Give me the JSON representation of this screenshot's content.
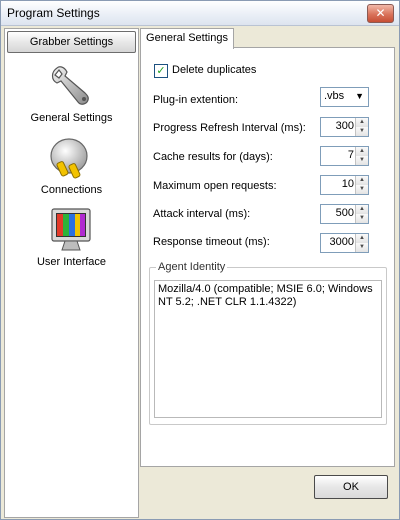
{
  "window": {
    "title": "Program Settings",
    "close_glyph": "✕"
  },
  "left": {
    "header": "Grabber Settings",
    "items": [
      {
        "label": "General Settings",
        "icon": "wrench-icon"
      },
      {
        "label": "Connections",
        "icon": "plug-icon"
      },
      {
        "label": "User Interface",
        "icon": "monitor-icon"
      }
    ]
  },
  "tab": {
    "label": "General Settings"
  },
  "settings": {
    "delete_duplicates": {
      "label": "Delete duplicates",
      "checked": true,
      "check_glyph": "✓"
    },
    "plugin_ext": {
      "label": "Plug-in extention:",
      "value": ".vbs",
      "arrow": "▼"
    },
    "progress_refresh": {
      "label": "Progress Refresh Interval (ms):",
      "value": "300"
    },
    "cache_results": {
      "label": "Cache results for (days):",
      "value": "7"
    },
    "max_requests": {
      "label": "Maximum open requests:",
      "value": "10"
    },
    "attack_interval": {
      "label": "Attack interval (ms):",
      "value": "500"
    },
    "response_timeout": {
      "label": "Response timeout (ms):",
      "value": "3000"
    },
    "spin_up": "▲",
    "spin_down": "▼"
  },
  "agent": {
    "legend": "Agent Identity",
    "value": "Mozilla/4.0 (compatible; MSIE 6.0; Windows NT 5.2; .NET CLR 1.1.4322)"
  },
  "buttons": {
    "ok": "OK"
  },
  "colors": {
    "accent_green": "#21a121",
    "close_red": "#c64e34"
  }
}
